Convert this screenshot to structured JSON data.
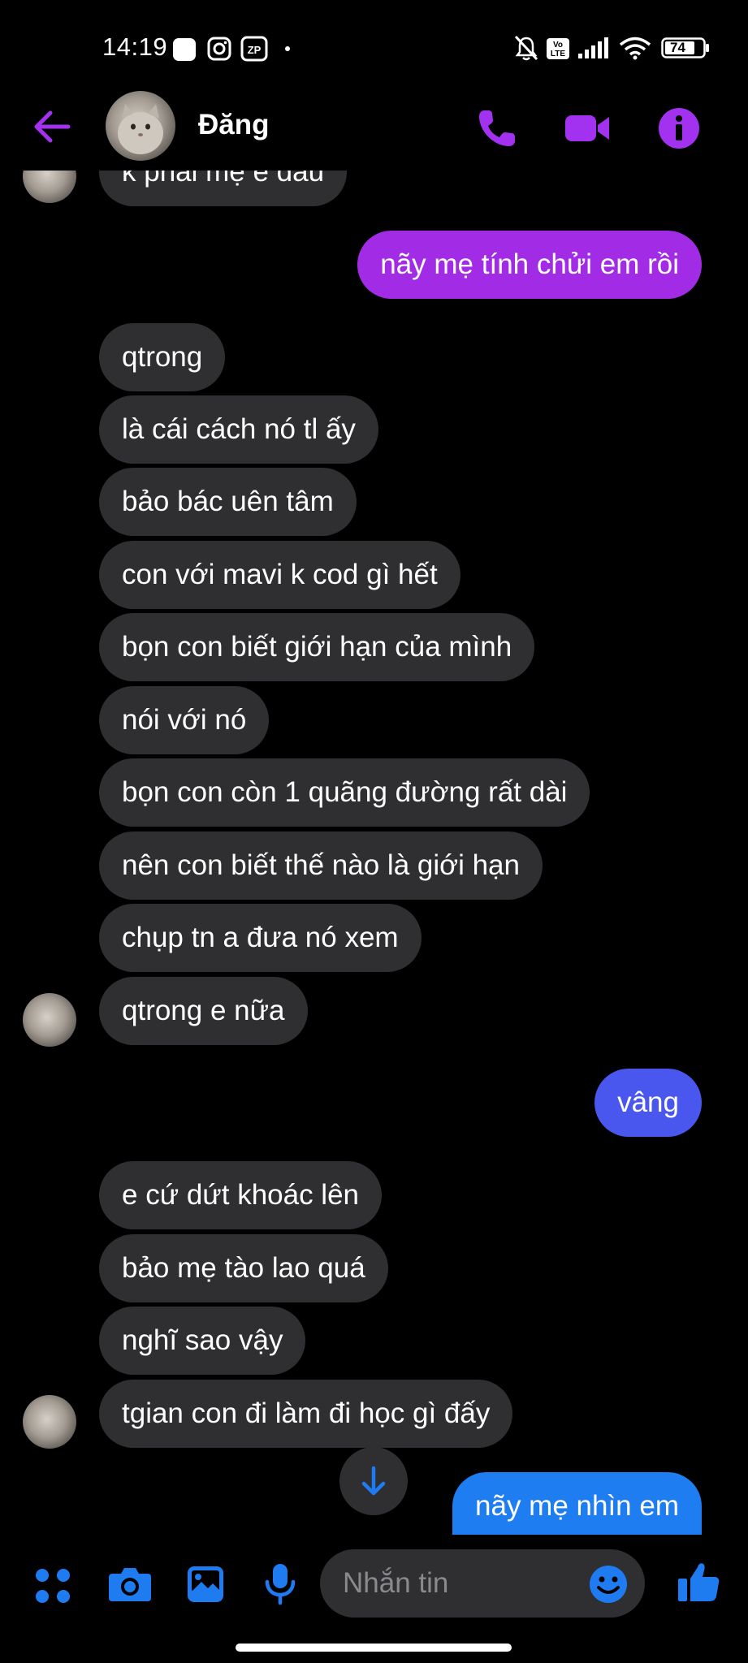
{
  "status": {
    "time": "14:19",
    "battery": "74",
    "volte": "Vo LTE"
  },
  "header": {
    "name": "Đăng"
  },
  "colors": {
    "accent": "#a232f0",
    "messenger_blue": "#1e7bf0",
    "outgoing_purple": "#a22be6",
    "outgoing_indigo": "#4a57ee",
    "outgoing_blue": "#1e7df0",
    "incoming_bg": "#2f2f31"
  },
  "messages": [
    {
      "text": "k phải mẹ e đâu",
      "dir": "in"
    },
    {
      "text": "nãy mẹ tính chửi em rồi",
      "dir": "out"
    },
    {
      "text": "qtrong",
      "dir": "in"
    },
    {
      "text": "là cái cách nó tl ấy",
      "dir": "in"
    },
    {
      "text": "bảo bác uên tâm",
      "dir": "in"
    },
    {
      "text": "con với mavi k cod gì hết",
      "dir": "in"
    },
    {
      "text": "bọn con biết giới hạn của mình",
      "dir": "in"
    },
    {
      "text": "nói  với nó",
      "dir": "in"
    },
    {
      "text": "bọn con còn 1 quãng đường rất dài",
      "dir": "in"
    },
    {
      "text": "nên con biết thế nào là giới hạn",
      "dir": "in"
    },
    {
      "text": "chụp tn a đưa nó xem",
      "dir": "in"
    },
    {
      "text": "qtrong e nữa",
      "dir": "in"
    },
    {
      "text": "vâng",
      "dir": "out"
    },
    {
      "text": "e cứ dứt khoác lên",
      "dir": "in"
    },
    {
      "text": "bảo mẹ tào lao quá",
      "dir": "in"
    },
    {
      "text": "nghĩ sao vậy",
      "dir": "in"
    },
    {
      "text": "tgian con đi làm đi học gì đấy",
      "dir": "in"
    },
    {
      "text": "nãy mẹ nhìn em",
      "dir": "out"
    }
  ],
  "composer": {
    "placeholder": "Nhắn tin"
  }
}
